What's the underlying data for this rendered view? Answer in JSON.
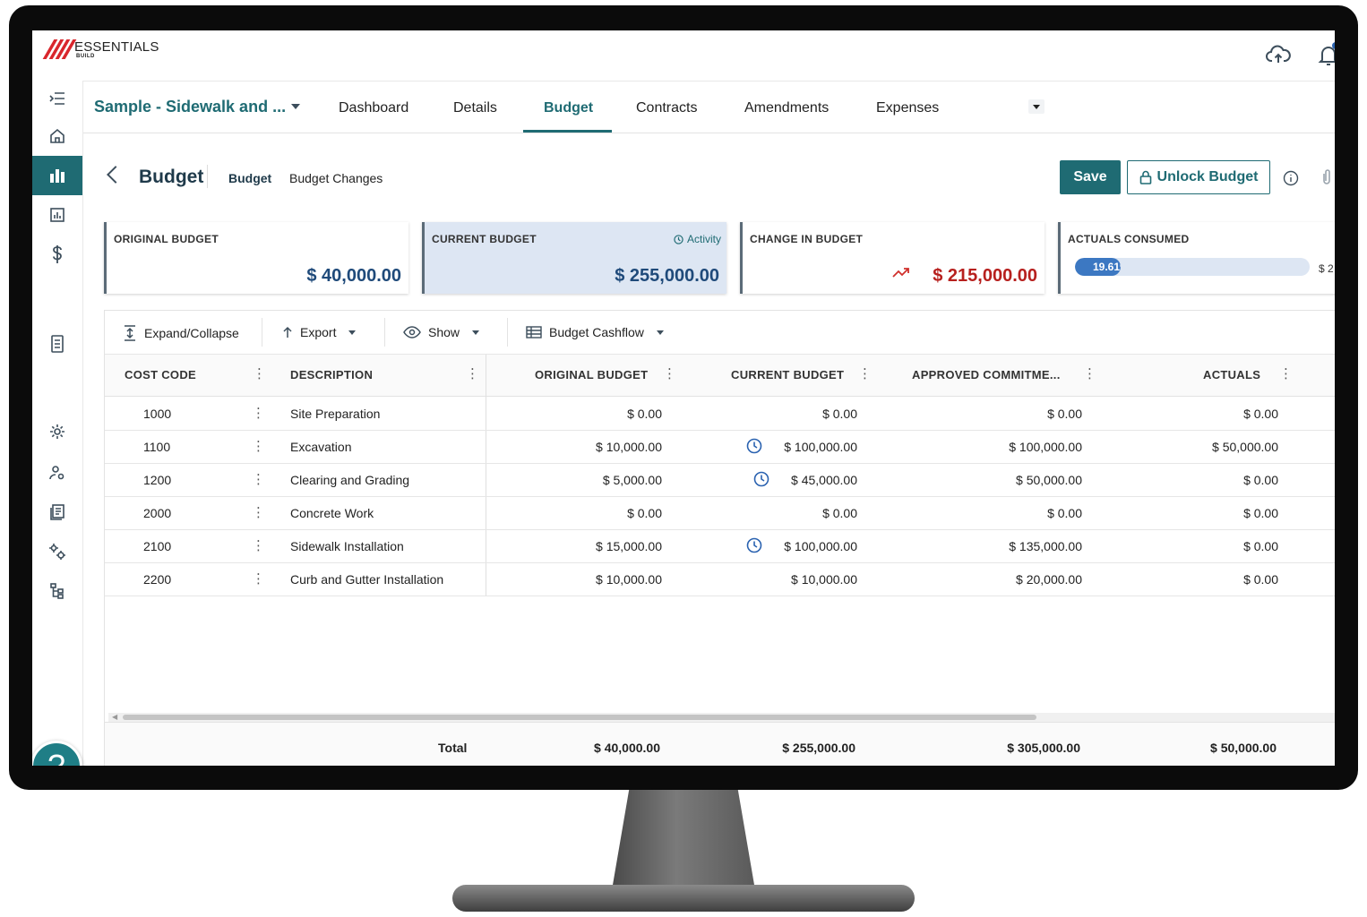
{
  "brand": {
    "name": "ESSENTIALS",
    "sub": "BUILD"
  },
  "project": {
    "title": "Sample - Sidewalk and ..."
  },
  "tabs": [
    {
      "label": "Dashboard"
    },
    {
      "label": "Details"
    },
    {
      "label": "Budget"
    },
    {
      "label": "Contracts"
    },
    {
      "label": "Amendments"
    },
    {
      "label": "Expenses"
    }
  ],
  "page": {
    "title": "Budget",
    "subtabs": [
      "Budget",
      "Budget Changes"
    ],
    "save_label": "Save",
    "unlock_label": "Unlock Budget"
  },
  "cards": {
    "original": {
      "label": "ORIGINAL BUDGET",
      "value": "$ 40,000.00"
    },
    "current": {
      "label": "CURRENT BUDGET",
      "value": "$ 255,000.00",
      "activity": "Activity"
    },
    "change": {
      "label": "CHANGE IN BUDGET",
      "value": "$ 215,000.00"
    },
    "actuals": {
      "label": "ACTUALS CONSUMED",
      "percent_text": "19.61%",
      "percent": 19.61,
      "amount": "$ 2"
    }
  },
  "toolbar": {
    "expand": "Expand/Collapse",
    "export": "Export",
    "show": "Show",
    "cashflow": "Budget Cashflow"
  },
  "columns": [
    "COST CODE",
    "DESCRIPTION",
    "ORIGINAL BUDGET",
    "CURRENT BUDGET",
    "APPROVED COMMITME...",
    "ACTUALS"
  ],
  "rows": [
    {
      "code": "1000",
      "desc": "Site Preparation",
      "orig": "$ 0.00",
      "curr": "$ 0.00",
      "commit": "$ 0.00",
      "actual": "$ 0.00",
      "activity": false
    },
    {
      "code": "1100",
      "desc": "Excavation",
      "orig": "$ 10,000.00",
      "curr": "$ 100,000.00",
      "commit": "$ 100,000.00",
      "actual": "$ 50,000.00",
      "activity": true
    },
    {
      "code": "1200",
      "desc": "Clearing and Grading",
      "orig": "$ 5,000.00",
      "curr": "$ 45,000.00",
      "commit": "$ 50,000.00",
      "actual": "$ 0.00",
      "activity": true
    },
    {
      "code": "2000",
      "desc": "Concrete Work",
      "orig": "$ 0.00",
      "curr": "$ 0.00",
      "commit": "$ 0.00",
      "actual": "$ 0.00",
      "activity": false
    },
    {
      "code": "2100",
      "desc": "Sidewalk Installation",
      "orig": "$ 15,000.00",
      "curr": "$ 100,000.00",
      "commit": "$ 135,000.00",
      "actual": "$ 0.00",
      "activity": true
    },
    {
      "code": "2200",
      "desc": "Curb and Gutter Installation",
      "orig": "$ 10,000.00",
      "curr": "$ 10,000.00",
      "commit": "$ 20,000.00",
      "actual": "$ 0.00",
      "activity": false
    }
  ],
  "totals": {
    "label": "Total",
    "orig": "$ 40,000.00",
    "curr": "$ 255,000.00",
    "commit": "$ 305,000.00",
    "actual": "$ 50,000.00"
  },
  "help": {
    "label": "?"
  },
  "colors": {
    "accent": "#1f6b73",
    "value_blue": "#1f4a7a",
    "value_red": "#b7201e",
    "progress": "#3c78c2",
    "logo_red": "#d9262c"
  }
}
